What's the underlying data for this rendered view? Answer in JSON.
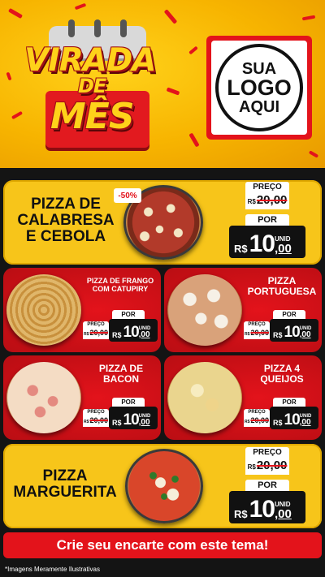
{
  "header": {
    "title_line1": "VIRADA",
    "title_line2": "DE",
    "title_line3": "MÊS",
    "logo": {
      "line1": "SUA",
      "line2": "LOGO",
      "line3": "AQUI"
    }
  },
  "price_labels": {
    "preco": "PREÇO",
    "por": "POR",
    "currency": "R$",
    "unit": "UNID"
  },
  "products": [
    {
      "name_l1": "PIZZA DE",
      "name_l2": "CALABRESA",
      "name_l3": "E CEBOLA",
      "badge": "-50%",
      "old_price": "20,00",
      "new_int": "10",
      "new_dec": ",00"
    },
    {
      "name_l1": "PIZZA DE FRANGO",
      "name_l2": "COM CATUPIRY",
      "old_price": "20,00",
      "new_int": "10",
      "new_dec": ",00"
    },
    {
      "name_l1": "PIZZA",
      "name_l2": "PORTUGUESA",
      "old_price": "20,00",
      "new_int": "10",
      "new_dec": ",00"
    },
    {
      "name_l1": "PIZZA DE",
      "name_l2": "BACON",
      "old_price": "20,00",
      "new_int": "10",
      "new_dec": ",00"
    },
    {
      "name_l1": "PIZZA 4",
      "name_l2": "QUEIJOS",
      "old_price": "20,00",
      "new_int": "10",
      "new_dec": ",00"
    },
    {
      "name_l1": "PIZZA",
      "name_l2": "MARGUERITA",
      "old_price": "20,00",
      "new_int": "10",
      "new_dec": ",00"
    }
  ],
  "cta": "Crie seu encarte com este tema!",
  "disclaimer": "*Imagens Meramente Ilustrativas",
  "colors": {
    "red": "#e3131b",
    "yellow": "#f7c51a",
    "dark": "#141414"
  }
}
